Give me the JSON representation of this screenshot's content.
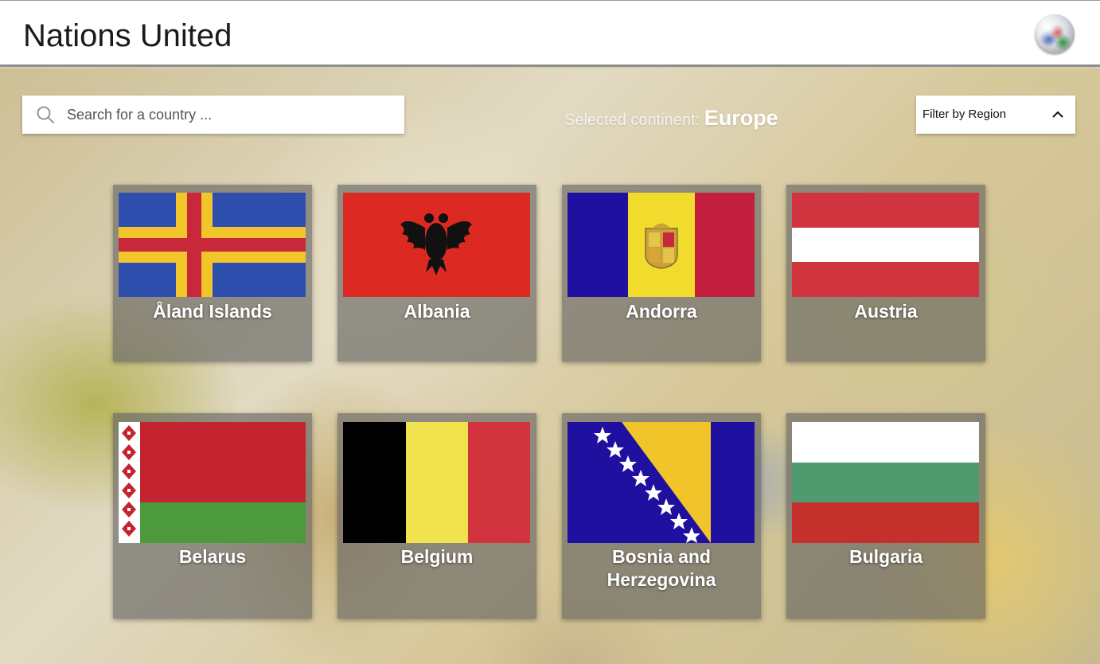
{
  "app": {
    "title": "Nations United"
  },
  "search": {
    "placeholder": "Search for a country ..."
  },
  "continent": {
    "prefix": "Selected continent:",
    "name": "Europe"
  },
  "filter": {
    "label": "Filter by Region"
  },
  "countries": [
    {
      "name": "Åland Islands"
    },
    {
      "name": "Albania"
    },
    {
      "name": "Andorra"
    },
    {
      "name": "Austria"
    },
    {
      "name": "Belarus"
    },
    {
      "name": "Belgium"
    },
    {
      "name": "Bosnia and Herzegovina"
    },
    {
      "name": "Bulgaria"
    }
  ]
}
